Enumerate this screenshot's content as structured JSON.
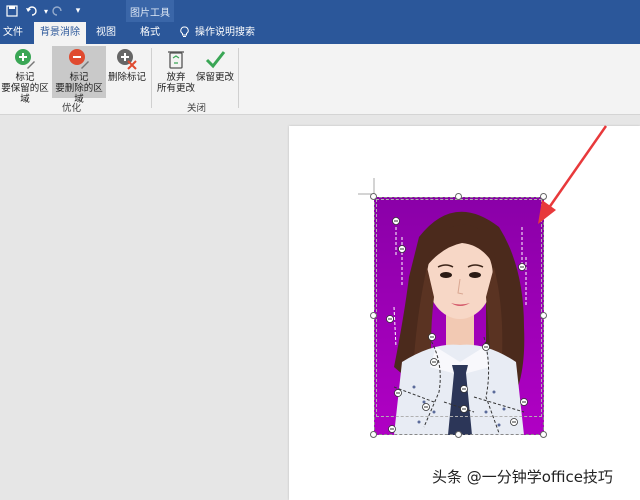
{
  "titlebar": {
    "context_label": "图片工具"
  },
  "tabs": [
    {
      "label": "文件"
    },
    {
      "label": "背景消除"
    },
    {
      "label": "视图"
    },
    {
      "label": "格式"
    }
  ],
  "tell_me": {
    "label": "操作说明搜索"
  },
  "ribbon": {
    "buttons": [
      {
        "line1": "标记",
        "line2": "要保留的区域"
      },
      {
        "line1": "标记",
        "line2": "要删除的区域"
      },
      {
        "line1": "删除标记",
        "line2": ""
      },
      {
        "line1": "放弃",
        "line2": "所有更改"
      },
      {
        "line1": "保留更改",
        "line2": ""
      }
    ],
    "groups": [
      {
        "label": "优化"
      },
      {
        "label": "关闭"
      }
    ]
  },
  "watermark": {
    "text": "头条 @一分钟学office技巧"
  },
  "colors": {
    "ribbon_blue": "#2b579a",
    "removal_overlay": "#a000b8",
    "arrow": "#e8393b"
  }
}
